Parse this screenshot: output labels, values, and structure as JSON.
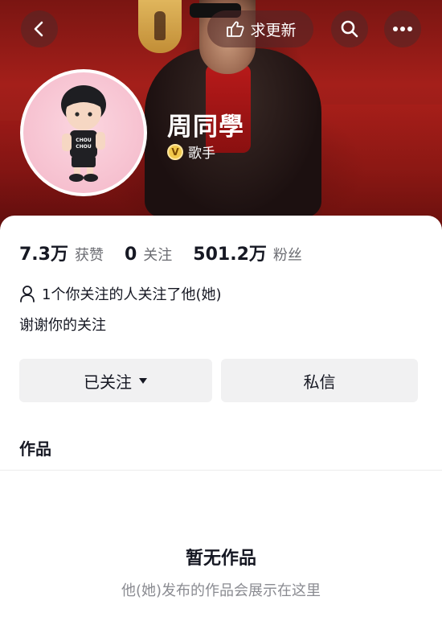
{
  "nav": {
    "back_icon": "chevron-left-icon",
    "update_label": "求更新",
    "update_icon": "thumb-point-icon",
    "search_icon": "search-icon",
    "more_icon": "more-dots-icon"
  },
  "profile": {
    "name": "周同學",
    "verify_badge": "V",
    "verify_label": "歌手",
    "avatar_shirt_text": "CHOU CHOU"
  },
  "stats": [
    {
      "value": "7.3万",
      "label": "获赞"
    },
    {
      "value": "0",
      "label": "关注"
    },
    {
      "value": "501.2万",
      "label": "粉丝"
    }
  ],
  "mutual": "1个你关注的人关注了他(她)",
  "bio": "谢谢你的关注",
  "actions": {
    "followed_label": "已关注",
    "message_label": "私信"
  },
  "works_tab": "作品",
  "empty": {
    "title": "暂无作品",
    "subtitle": "他(她)发布的作品会展示在这里"
  },
  "colors": {
    "banner": "#a41f1a",
    "button_bg": "#f1f1f2",
    "verify_badge": "#f2c94c"
  }
}
